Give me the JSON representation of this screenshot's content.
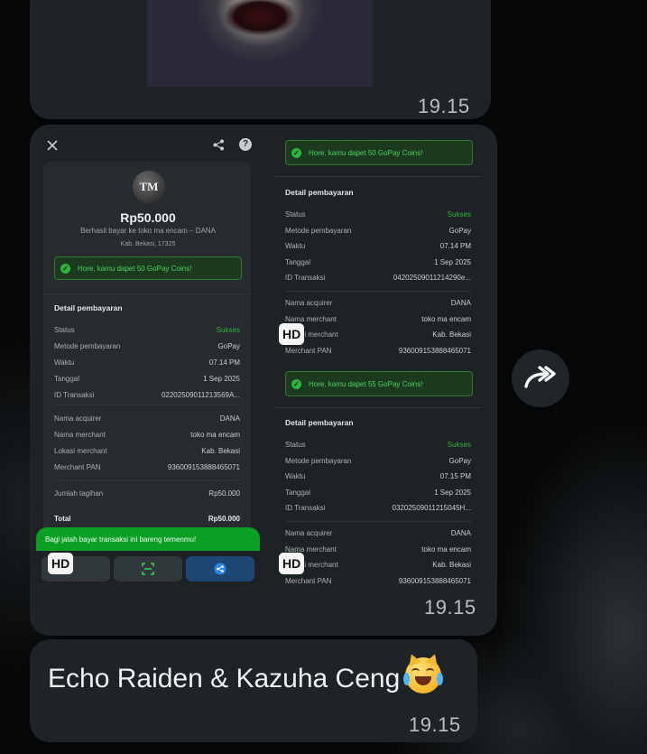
{
  "messages": {
    "top": {
      "time": "19.15"
    },
    "album": {
      "time": "19.15",
      "hd_label": "HD",
      "receipt_main": {
        "initials": "TM",
        "amount": "Rp50.000",
        "paid_to": "Berhasil bayar ke toko ma encam – DANA",
        "location": "Kab. Bekasi, 17325",
        "coins_banner": "Hore, kamu dapet 50 GoPay Coins!",
        "section_title": "Detail pembayaran",
        "rows": [
          {
            "label": "Status",
            "value": "Sukses"
          },
          {
            "label": "Metode pembayaran",
            "value": "GoPay"
          },
          {
            "label": "Waktu",
            "value": "07.14 PM"
          },
          {
            "label": "Tanggal",
            "value": "1 Sep 2025"
          },
          {
            "label": "ID Transaksi",
            "value": "02202509011213569A..."
          }
        ],
        "rows2": [
          {
            "label": "Nama acquirer",
            "value": "DANA"
          },
          {
            "label": "Nama merchant",
            "value": "toko ma encam"
          },
          {
            "label": "Lokasi merchant",
            "value": "Kab. Bekasi"
          },
          {
            "label": "Merchant PAN",
            "value": "936009153888465071"
          }
        ],
        "jumlah": {
          "label": "Jumlah tagihan",
          "value": "Rp50.000"
        },
        "total": {
          "label": "Total",
          "value": "Rp50.000"
        },
        "share_banner": "Bagi jatah bayar transaksi ini bareng temenmu!"
      },
      "receipt_2": {
        "coins_banner": "Hore, kamu dapet 50 GoPay Coins!",
        "section_title": "Detail pembayaran",
        "rows": [
          {
            "label": "Status",
            "value": "Sukses"
          },
          {
            "label": "Metode pembayaran",
            "value": "GoPay"
          },
          {
            "label": "Waktu",
            "value": "07.14 PM"
          },
          {
            "label": "Tanggal",
            "value": "1 Sep 2025"
          },
          {
            "label": "ID Transaksi",
            "value": "04202509011214290e..."
          }
        ],
        "rows2": [
          {
            "label": "Nama acquirer",
            "value": "DANA"
          },
          {
            "label": "Nama merchant",
            "value": "toko ma encam"
          },
          {
            "label": "Lokasi merchant",
            "value": "Kab. Bekasi"
          },
          {
            "label": "Merchant PAN",
            "value": "936009153888465071"
          }
        ]
      },
      "receipt_3": {
        "coins_banner": "Hore, kamu dapet 55 GoPay Coins!",
        "section_title": "Detail pembayaran",
        "rows": [
          {
            "label": "Status",
            "value": "Sukses"
          },
          {
            "label": "Metode pembayaran",
            "value": "GoPay"
          },
          {
            "label": "Waktu",
            "value": "07.15 PM"
          },
          {
            "label": "Tanggal",
            "value": "1 Sep 2025"
          },
          {
            "label": "ID Transaksi",
            "value": "03202509011215045H..."
          }
        ],
        "rows2": [
          {
            "label": "Nama acquirer",
            "value": "DANA"
          },
          {
            "label": "Nama merchant",
            "value": "toko ma encam"
          },
          {
            "label": "Lokasi merchant",
            "value": "Kab. Bekasi"
          },
          {
            "label": "Merchant PAN",
            "value": "936009153888465071"
          }
        ]
      }
    },
    "text": {
      "body": "Echo Raiden & Kazuha Ceng",
      "time": "19.15"
    }
  },
  "icons": [
    "close-icon",
    "share-icon",
    "help-icon",
    "forward-icon",
    "copy-icon",
    "check-icon",
    "qr-scan-icon",
    "laughing-cat-emoji"
  ],
  "colors": {
    "bubble": "#1e2326",
    "accent_green": "#2fb33e",
    "share_banner": "#0a9f25"
  }
}
